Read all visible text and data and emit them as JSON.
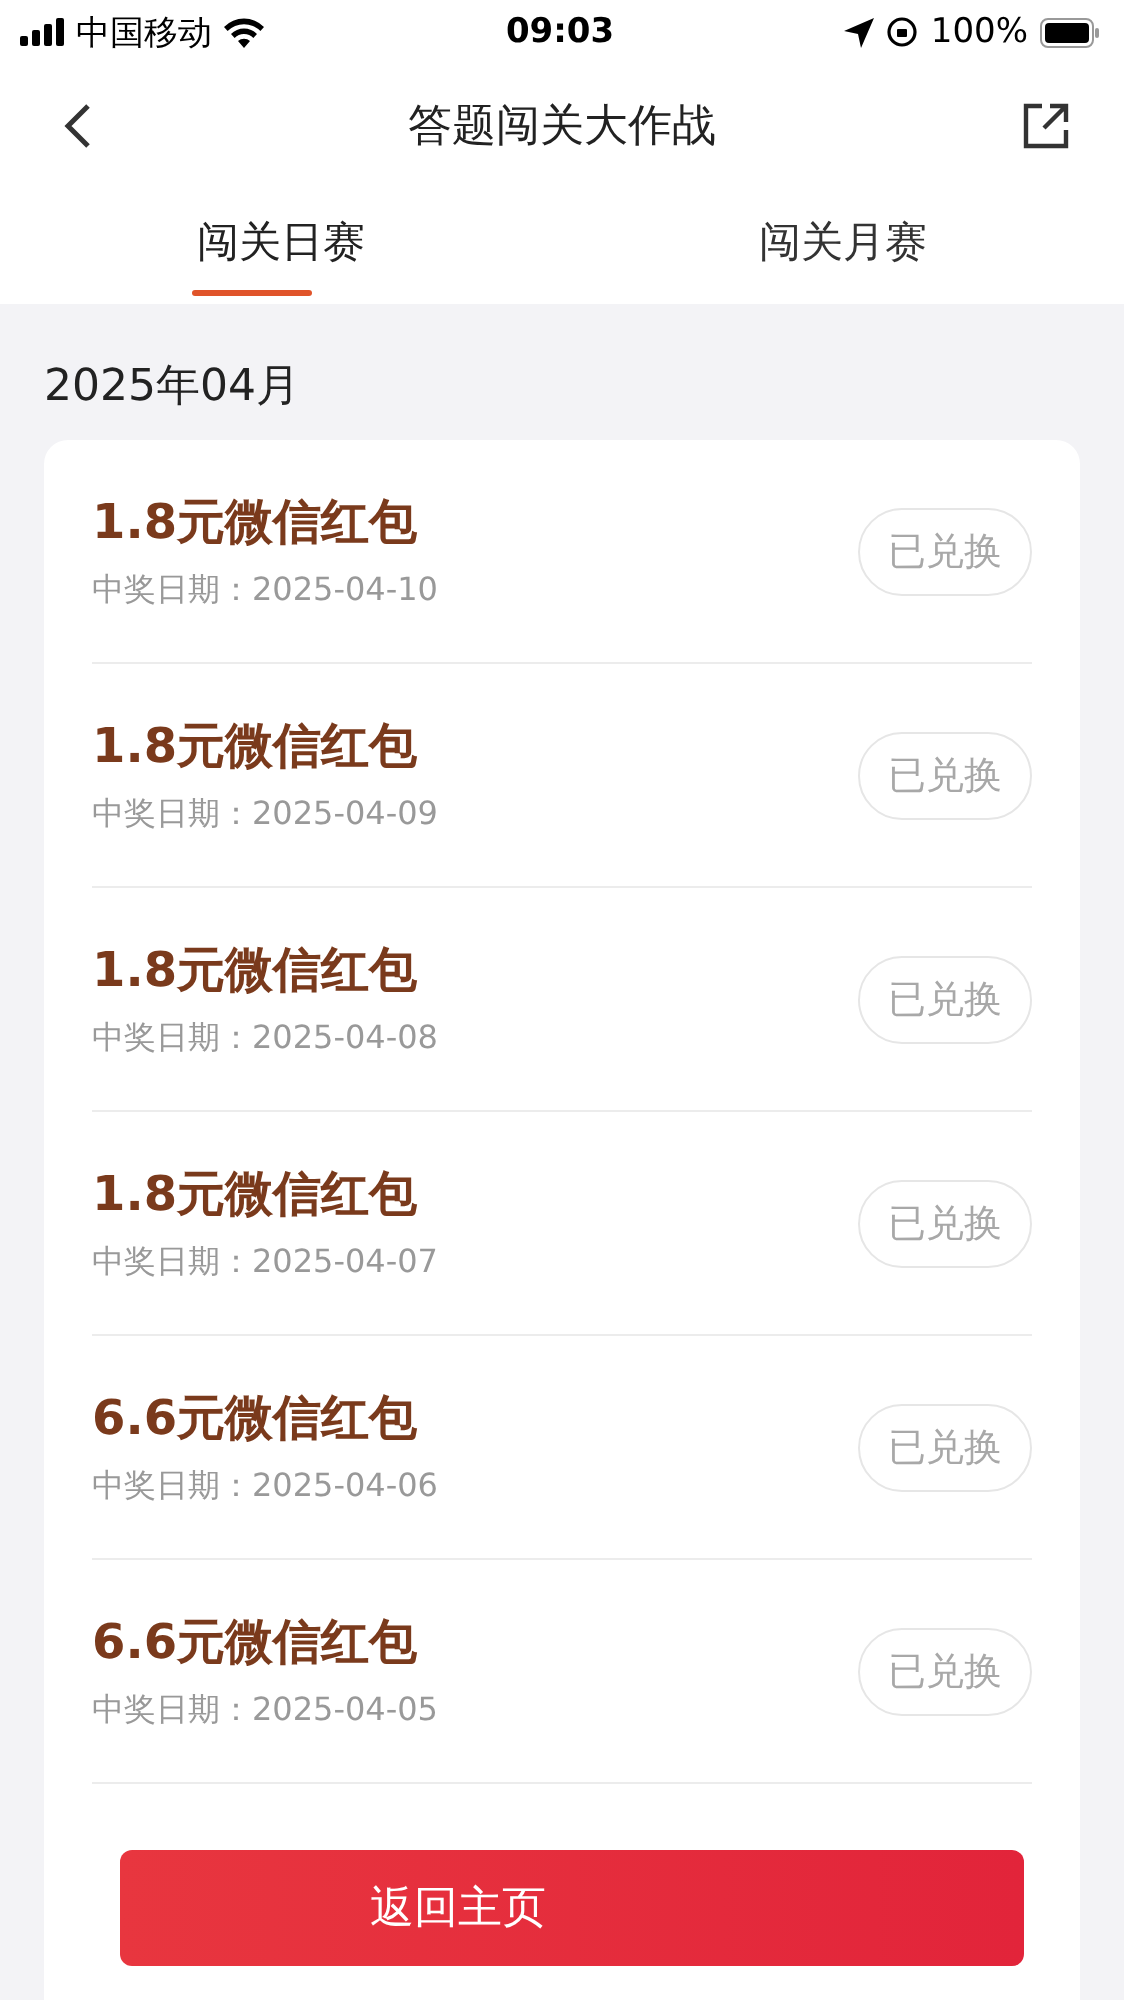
{
  "status_bar": {
    "carrier": "中国移动",
    "time": "09:03",
    "battery": "100%"
  },
  "header": {
    "title": "答题闯关大作战"
  },
  "tabs": [
    {
      "label": "闯关日赛",
      "selected": true
    },
    {
      "label": "闯关月赛",
      "selected": false
    }
  ],
  "month": "2025年04月",
  "prizes": [
    {
      "title": "1.8元微信红包",
      "date_label": "中奖日期：",
      "date": "2025-04-10",
      "button": "已兑换",
      "disabled": true
    },
    {
      "title": "1.8元微信红包",
      "date_label": "中奖日期：",
      "date": "2025-04-09",
      "button": "已兑换",
      "disabled": true
    },
    {
      "title": "1.8元微信红包",
      "date_label": "中奖日期：",
      "date": "2025-04-08",
      "button": "已兑换",
      "disabled": true
    },
    {
      "title": "1.8元微信红包",
      "date_label": "中奖日期：",
      "date": "2025-04-07",
      "button": "已兑换",
      "disabled": true
    },
    {
      "title": "6.6元微信红包",
      "date_label": "中奖日期：",
      "date": "2025-04-06",
      "button": "已兑换",
      "disabled": true
    },
    {
      "title": "6.6元微信红包",
      "date_label": "中奖日期：",
      "date": "2025-04-05",
      "button": "已兑换",
      "disabled": true
    }
  ],
  "home_button": "返回主页"
}
